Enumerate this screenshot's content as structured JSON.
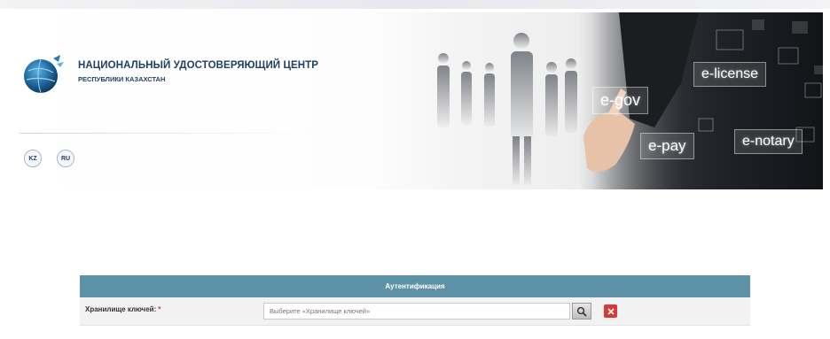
{
  "header": {
    "org_name": "НАЦИОНАЛЬНЫЙ УДОСТОВЕРЯЮЩИЙ ЦЕНТР",
    "org_subtitle": "РЕСПУБЛИКИ КАЗАХСТАН",
    "logo_icon": "globe-icon",
    "languages": [
      {
        "code": "KZ"
      },
      {
        "code": "RU"
      }
    ]
  },
  "banner": {
    "tags": [
      "e-gov",
      "e-license",
      "e-pay",
      "e-notary"
    ]
  },
  "auth": {
    "title": "Аутентификация",
    "store_label": "Хранилище ключей:",
    "required_mark": "*",
    "store_placeholder": "Выберите «Хранилище ключей»",
    "search_icon": "search-icon",
    "clear_icon": "close-icon"
  },
  "colors": {
    "brand": "#1f3f66",
    "auth_header": "#5d91a6",
    "clear_button": "#d63a3a"
  }
}
